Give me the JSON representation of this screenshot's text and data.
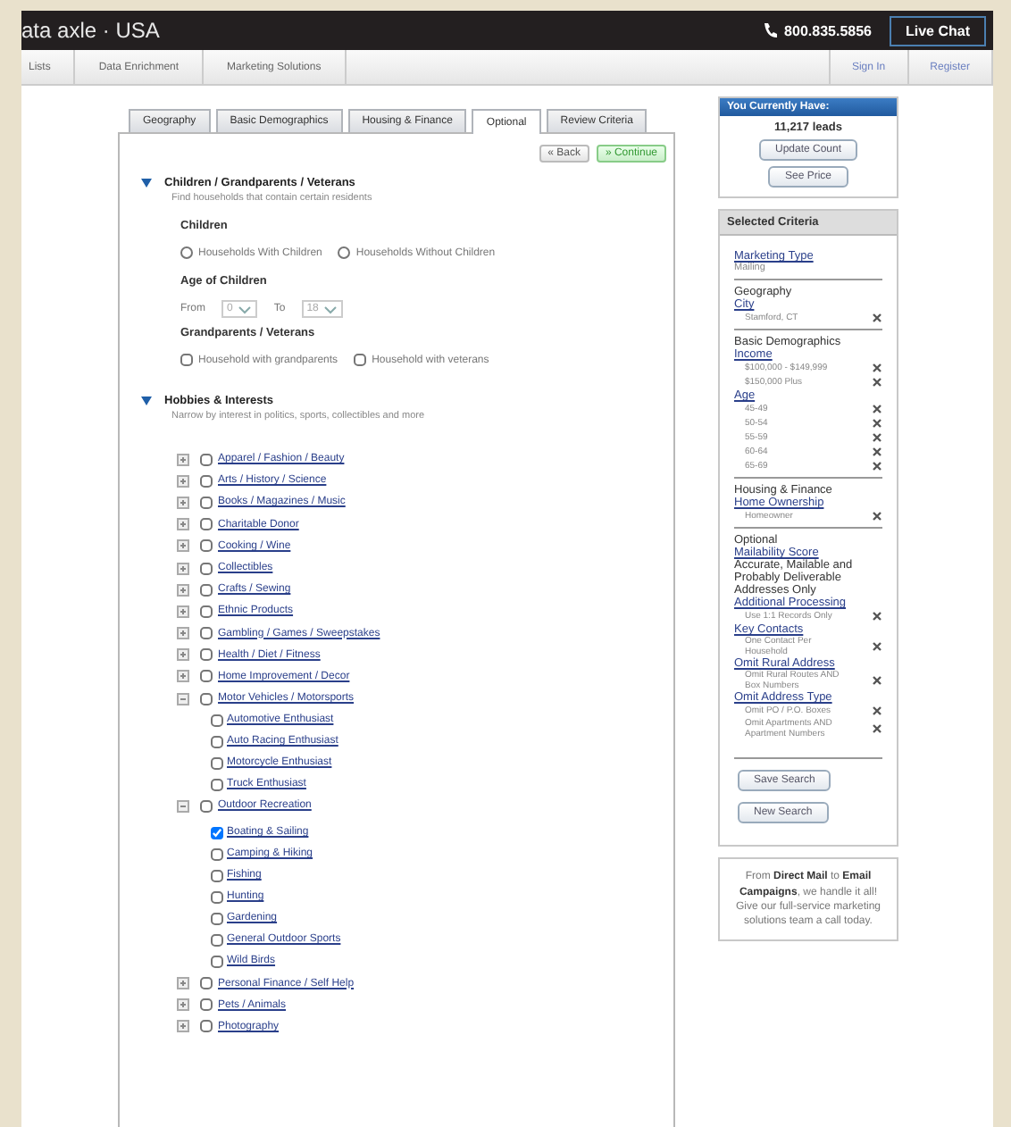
{
  "header": {
    "logo": "ata axle · USA",
    "phone": "800.835.5856",
    "chat_button": "Live Chat"
  },
  "nav": {
    "left": [
      "Lists",
      "Data Enrichment",
      "Marketing Solutions"
    ],
    "right": [
      "Sign In",
      "Register"
    ]
  },
  "tabs": [
    {
      "label": "Geography",
      "selected": false
    },
    {
      "label": "Basic Demographics",
      "selected": false
    },
    {
      "label": "Housing & Finance",
      "selected": false
    },
    {
      "label": "Optional",
      "selected": true
    },
    {
      "label": "Review Criteria",
      "selected": false
    }
  ],
  "actions": {
    "back": "« Back",
    "continue": "» Continue"
  },
  "children_section": {
    "title": "Children / Grandparents / Veterans",
    "hint": "Find households that contain certain residents",
    "expanded": true,
    "children_label": "Children",
    "radios": [
      {
        "label": "Households With Children",
        "selected": false
      },
      {
        "label": "Households Without Children",
        "selected": false
      }
    ],
    "age_label": "Age of Children",
    "from_label": "From",
    "from_value": "0",
    "to_label": "To",
    "to_value": "18",
    "grand_label": "Grandparents / Veterans",
    "checkboxes": [
      {
        "label": "Household with grandparents",
        "checked": false
      },
      {
        "label": "Household with veterans",
        "checked": false
      }
    ]
  },
  "hobbies_section": {
    "title": "Hobbies & Interests",
    "hint": "Narrow by interest in politics, sports, collectibles and more",
    "expanded": true,
    "items": [
      {
        "label": "Apparel / Fashion / Beauty",
        "checked": false,
        "expanded": false
      },
      {
        "label": "Arts / History / Science",
        "checked": false,
        "expanded": false
      },
      {
        "label": "Books / Magazines / Music",
        "checked": false,
        "expanded": false
      },
      {
        "label": "Charitable Donor",
        "checked": false,
        "expanded": false
      },
      {
        "label": "Cooking / Wine",
        "checked": false,
        "expanded": false
      },
      {
        "label": "Collectibles",
        "checked": false,
        "expanded": false
      },
      {
        "label": "Crafts / Sewing",
        "checked": false,
        "expanded": false
      },
      {
        "label": "Ethnic Products",
        "checked": false,
        "expanded": false
      },
      {
        "label": "Gambling / Games / Sweepstakes",
        "checked": false,
        "expanded": false
      },
      {
        "label": "Health / Diet / Fitness",
        "checked": false,
        "expanded": false
      },
      {
        "label": "Home Improvement / Decor",
        "checked": false,
        "expanded": false
      },
      {
        "label": "Motor Vehicles / Motorsports",
        "checked": false,
        "expanded": true,
        "children": [
          {
            "label": "Automotive Enthusiast",
            "checked": false
          },
          {
            "label": "Auto Racing Enthusiast",
            "checked": false
          },
          {
            "label": "Motorcycle Enthusiast",
            "checked": false
          },
          {
            "label": "Truck Enthusiast",
            "checked": false
          }
        ]
      },
      {
        "label": "Outdoor Recreation",
        "checked": false,
        "expanded": true,
        "children": [
          {
            "label": "Boating & Sailing",
            "checked": true
          },
          {
            "label": "Camping & Hiking",
            "checked": false
          },
          {
            "label": "Fishing",
            "checked": false
          },
          {
            "label": "Hunting",
            "checked": false
          },
          {
            "label": "Gardening",
            "checked": false
          },
          {
            "label": "General Outdoor Sports",
            "checked": false
          },
          {
            "label": "Wild Birds",
            "checked": false
          }
        ]
      },
      {
        "label": "Personal Finance / Self Help",
        "checked": false,
        "expanded": false
      },
      {
        "label": "Pets / Animals",
        "checked": false,
        "expanded": false
      },
      {
        "label": "Photography",
        "checked": false,
        "expanded": false
      }
    ]
  },
  "sidebar": {
    "count_title": "You Currently Have:",
    "count": "11,217 leads",
    "update_button": "Update Count",
    "price_button": "See Price",
    "criteria_title": "Selected Criteria",
    "marketing": {
      "title": "Marketing Type",
      "value": "Mailing"
    },
    "groups": [
      {
        "title": "Geography",
        "fields": [
          {
            "name": "City",
            "kind": "removable",
            "values": [
              "Stamford, CT"
            ]
          }
        ]
      },
      {
        "title": "Basic Demographics",
        "fields": [
          {
            "name": "Income",
            "kind": "removable",
            "values": [
              "$100,000 - $149,999",
              "$150,000 Plus"
            ]
          },
          {
            "name": "Age",
            "kind": "removable",
            "values": [
              "45-49",
              "50-54",
              "55-59",
              "60-64",
              "65-69"
            ]
          }
        ]
      },
      {
        "title": "Housing & Finance",
        "fields": [
          {
            "name": "Home Ownership",
            "kind": "removable",
            "values": [
              "Homeowner"
            ]
          }
        ]
      },
      {
        "title": "Optional",
        "fields": [
          {
            "name": "Mailability Score",
            "kind": "note",
            "values": [
              "Accurate, Mailable and Probably Deliverable Addresses Only"
            ]
          },
          {
            "name": "Additional Processing",
            "kind": "removable",
            "values": [
              "Use 1:1 Records Only"
            ]
          },
          {
            "name": "Key Contacts",
            "kind": "removable",
            "values": [
              "One Contact Per Household"
            ]
          },
          {
            "name": "Omit Rural Address",
            "kind": "removable",
            "values": [
              "Omit Rural Routes AND Box Numbers"
            ]
          },
          {
            "name": "Omit Address Type",
            "kind": "removable",
            "values": [
              "Omit PO / P.O. Boxes",
              "Omit Apartments AND Apartment Numbers"
            ]
          }
        ]
      }
    ],
    "save_button": "Save Search",
    "new_button": "New Search",
    "promo": "From **Direct Mail** to **Email Campaigns**, we handle it all! Give our full-service marketing solutions team a call today."
  }
}
